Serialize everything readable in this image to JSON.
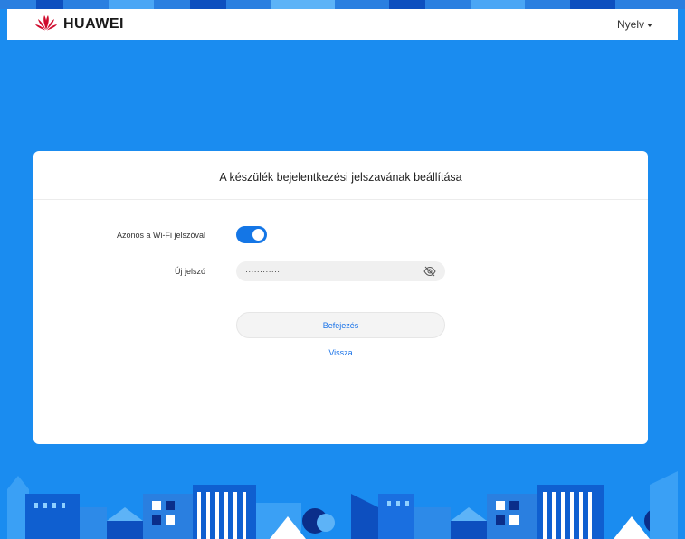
{
  "header": {
    "brand": "HUAWEI",
    "language_label": "Nyelv"
  },
  "card": {
    "title": "A készülék bejelentkezési jelszavának beállítása",
    "same_as_wifi_label": "Azonos a Wi-Fi jelszóval",
    "same_as_wifi_enabled": true,
    "new_password_label": "Új jelszó",
    "new_password_value": "············",
    "finish_button": "Befejezés",
    "back_link": "Vissza"
  },
  "icons": {
    "logo": "huawei-flower-logo",
    "language_caret": "caret-down-icon",
    "password_visibility": "eye-slash-icon"
  },
  "colors": {
    "background": "#1a8cf0",
    "accent": "#1476e6",
    "link": "#1a73e8",
    "brand_red": "#cf0a2c"
  }
}
